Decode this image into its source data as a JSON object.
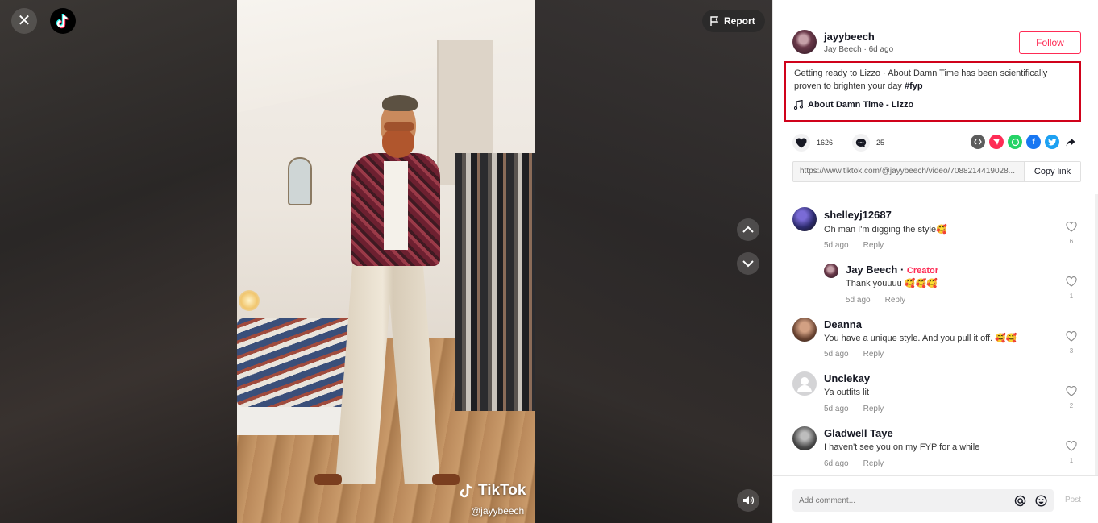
{
  "stage": {
    "report_label": "Report",
    "watermark_brand": "TikTok",
    "watermark_handle": "@jayybeech"
  },
  "post": {
    "username": "jayybeech",
    "display_name": "Jay Beech",
    "age": "6d ago",
    "follow_label": "Follow",
    "description": "Getting ready to Lizzo · About Damn Time has been scientifically proven to brighten your day",
    "hashtag": "#fyp",
    "music": "About Damn Time - Lizzo",
    "likes": "1626",
    "comments_count": "25",
    "link": "https://www.tiktok.com/@jayybeech/video/7088214419028...",
    "copy_label": "Copy link"
  },
  "comments": [
    {
      "name": "shelleyj12687",
      "text": "Oh man I'm digging the style🥰",
      "time": "5d ago",
      "reply": "Reply",
      "likes": "6"
    },
    {
      "name": "Jay Beech",
      "badge": "Creator",
      "text": "Thank youuuu 🥰🥰🥰",
      "time": "5d ago",
      "reply": "Reply",
      "likes": "1"
    },
    {
      "name": "Deanna",
      "text": "You have a unique style. And you pull it off. 🥰🥰",
      "time": "5d ago",
      "reply": "Reply",
      "likes": "3"
    },
    {
      "name": "Unclekay",
      "text": "Ya outfits lit",
      "time": "5d ago",
      "reply": "Reply",
      "likes": "2"
    },
    {
      "name": "Gladwell Taye",
      "text": "I haven't see you on my FYP for a while",
      "time": "6d ago",
      "reply": "Reply",
      "likes": "1"
    }
  ],
  "footer": {
    "placeholder": "Add comment...",
    "post_label": "Post"
  },
  "colors": {
    "accent": "#fe2c55",
    "highlight_border": "#d0021b"
  }
}
